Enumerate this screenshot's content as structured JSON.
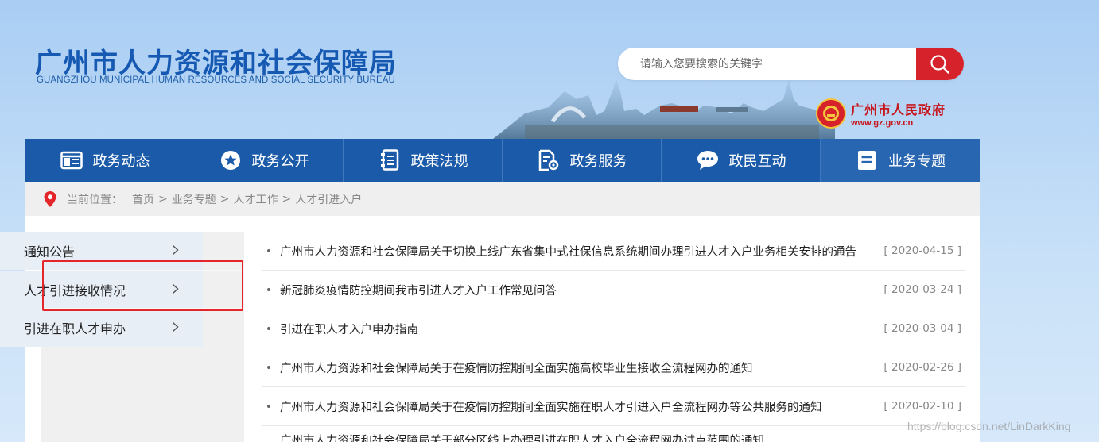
{
  "header": {
    "title": "广州市人力资源和社会保障局",
    "subtitle": "GUANGZHOU MUNICIPAL HUMAN RESOURCES AND SOCIAL SECURITY BUREAU",
    "search_placeholder": "请输入您要搜索的关键字",
    "search_value": "",
    "gov_name": "广州市人民政府",
    "gov_url": "www.gz.gov.cn"
  },
  "nav": {
    "items": [
      {
        "label": "政务动态",
        "icon": "news-panel-icon"
      },
      {
        "label": "政务公开",
        "icon": "star-circle-icon"
      },
      {
        "label": "政策法规",
        "icon": "book-icon"
      },
      {
        "label": "政务服务",
        "icon": "document-gear-icon"
      },
      {
        "label": "政民互动",
        "icon": "chat-bubble-icon"
      },
      {
        "label": "业务专题",
        "icon": "list-doc-icon"
      }
    ],
    "active_index": 5
  },
  "breadcrumb": {
    "prefix": "当前位置：",
    "items": [
      "首页",
      "业务专题",
      "人才工作",
      "人才引进入户"
    ],
    "separator": ">"
  },
  "sidebar": {
    "items": [
      {
        "label": "通知公告"
      },
      {
        "label": "人才引进接收情况"
      },
      {
        "label": "引进在职人才申办"
      }
    ],
    "highlighted_index": 1
  },
  "news": {
    "items": [
      {
        "title": "广州市人力资源和社会保障局关于切换上线广东省集中式社保信息系统期间办理引进人才入户业务相关安排的通告",
        "date": "[ 2020-04-15 ]"
      },
      {
        "title": "新冠肺炎疫情防控期间我市引进人才入户工作常见问答",
        "date": "[ 2020-03-24 ]"
      },
      {
        "title": "引进在职人才入户申办指南",
        "date": "[ 2020-03-04 ]"
      },
      {
        "title": "广州市人力资源和社会保障局关于在疫情防控期间全面实施高校毕业生接收全流程网办的通知",
        "date": "[ 2020-02-26 ]"
      },
      {
        "title": "广州市人力资源和社会保障局关于在疫情防控期间全面实施在职人才引进入户全流程网办等公共服务的通知",
        "date": "[ 2020-02-10 ]"
      }
    ],
    "partial_item": "广州市人力资源和社会保障局关于部分区线上办理引进在职人才入户全流程网办试点范围的通知"
  },
  "watermark": "https://blog.csdn.net/LinDarkKing",
  "colors": {
    "brand_blue": "#1a5aa8",
    "accent_red": "#d6222a",
    "highlight_red": "#e4262b"
  }
}
